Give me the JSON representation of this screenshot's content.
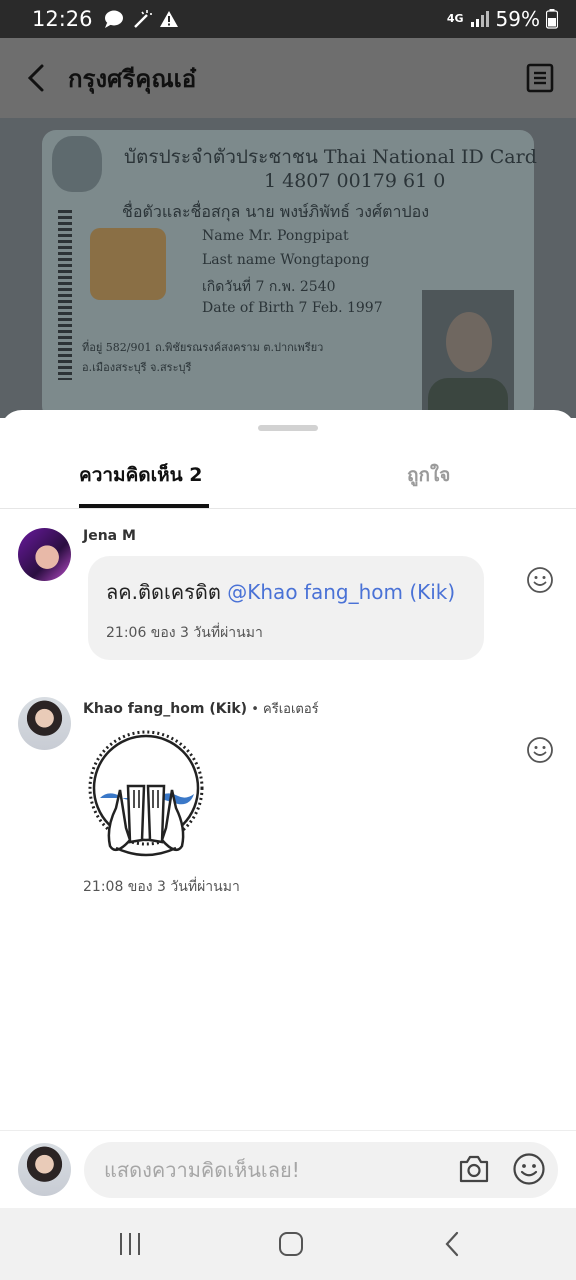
{
  "status_bar": {
    "time": "12:26",
    "network": "4G",
    "battery": "59%",
    "icons": [
      "chat-bubble-icon",
      "magic-wand-icon",
      "warning-icon",
      "signal-icon",
      "battery-icon"
    ]
  },
  "app_bar": {
    "title": "กรุงศรีคุณเอ๋",
    "icons": [
      "back-arrow-icon",
      "document-icon"
    ]
  },
  "background_photo": {
    "card_lines": [
      "บัตรประจำตัวประชาชน Thai National ID Card",
      "1 4807 00179 61 0",
      "ชื่อตัวและชื่อสกุล นาย พงษ์ภิพัทธ์ วงศ์ตาปอง",
      "Name Mr. Pongpipat",
      "Last name Wongtapong",
      "เกิดวันที่ 7 ก.พ. 2540",
      "Date of Birth 7 Feb. 1997",
      "ที่อยู่ 582/901 ถ.พิชัยรณรงค์สงคราม ต.ปากเพรียว",
      "อ.เมืองสระบุรี จ.สระบุรี"
    ]
  },
  "tabs": [
    {
      "label": "ความคิดเห็น 2",
      "active": true
    },
    {
      "label": "ถูกใจ",
      "active": false
    }
  ],
  "comments": [
    {
      "author": "Jena M",
      "text": "ลค.ติดเครดิต ",
      "mention": "@Khao fang_hom (Kik)",
      "time": "21:06 ของ 3 วันที่ผ่านมา"
    },
    {
      "author": "Khao fang_hom (Kik)",
      "separator": " • ",
      "badge": "ครีเอเตอร์",
      "sticker": "crying-face-sticker",
      "time": "21:08 ของ 3 วันที่ผ่านมา"
    }
  ],
  "input": {
    "placeholder": "แสดงความคิดเห็นเลย!"
  },
  "colors": {
    "mention": "#4a72d6",
    "sticker_tears": "#3a78c8"
  }
}
